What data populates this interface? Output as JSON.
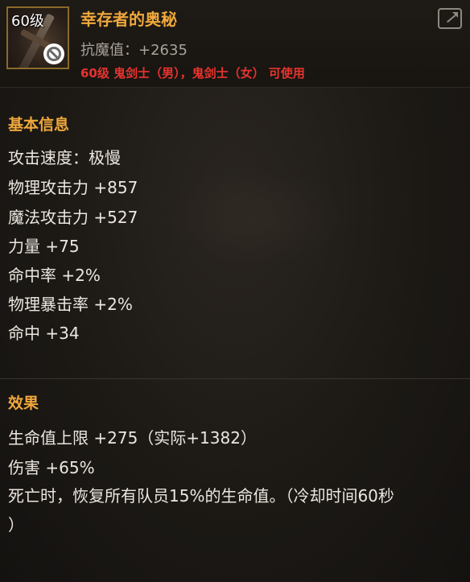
{
  "item": {
    "level_badge": "60级",
    "name": "幸存者的奥秘",
    "magic_resist": "抗魔值：+2635",
    "usage_restriction": "60级 鬼剑士（男），鬼剑士（女） 可使用",
    "icon": "weapon-icon"
  },
  "basic_info": {
    "title": "基本信息",
    "lines": [
      "攻击速度：极慢",
      "物理攻击力 +857",
      "魔法攻击力 +527",
      "力量 +75",
      "命中率 +2%",
      "物理暴击率 +2%",
      "命中 +34"
    ]
  },
  "effects": {
    "title": "效果",
    "lines": [
      "生命值上限 +275（实际+1382）",
      "伤害 +65%",
      "死亡时，恢复所有队员15%的生命值。（冷却时间60秒",
      "）"
    ]
  },
  "colors": {
    "accent": "#f0a83c",
    "usage": "#e8332e",
    "text": "#ece6df",
    "muted": "#a8a29a"
  }
}
